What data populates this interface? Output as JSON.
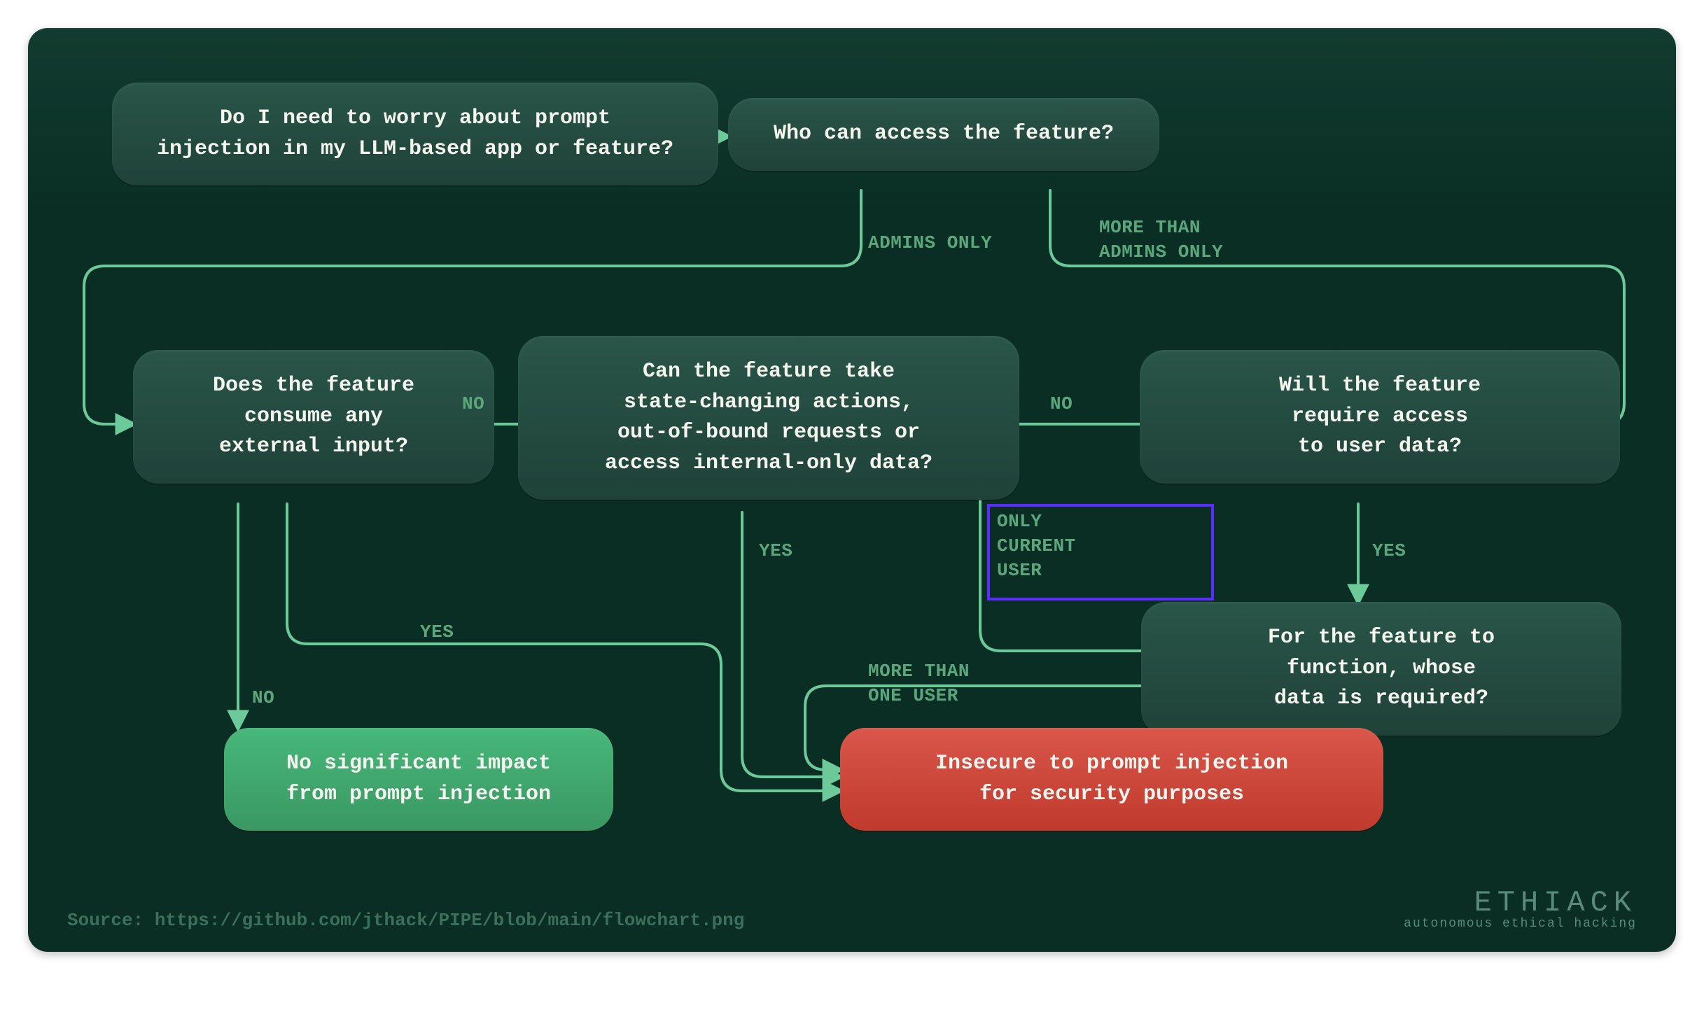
{
  "nodes": {
    "start": "Do I need to worry about prompt\ninjection in my LLM-based app or feature?",
    "access": "Who can access the feature?",
    "external": "Does the feature\nconsume any\nexternal input?",
    "stateChanging": "Can the feature take\nstate-changing actions,\nout-of-bound requests or\naccess internal-only data?",
    "userData": "Will the feature\nrequire access\nto user data?",
    "whoseData": "For the feature to\nfunction, whose\ndata is required?",
    "safe": "No significant impact\nfrom prompt injection",
    "insecure": "Insecure to prompt injection\nfor security purposes"
  },
  "edges": {
    "adminsOnly": "ADMINS ONLY",
    "moreThanAdmins": "MORE THAN\nADMINS ONLY",
    "no1": "NO",
    "no2": "NO",
    "no3": "NO",
    "yes1": "YES",
    "yes2": "YES",
    "yes3": "YES",
    "onlyCurrentUser": "ONLY\nCURRENT\nUSER",
    "moreThanOneUser": "MORE THAN\nONE USER"
  },
  "source": "Source: https://github.com/jthack/PIPE/blob/main/flowchart.png",
  "brand": {
    "logo": "ETHIACK",
    "tagline": "autonomous ethical hacking"
  },
  "colors": {
    "canvas": "#0a2e24",
    "node": "#2a5549",
    "edge": "#6cc99a",
    "safeResult": "#3fa06a",
    "insecureResult": "#d04a3a",
    "highlight": "#5a2cff"
  }
}
